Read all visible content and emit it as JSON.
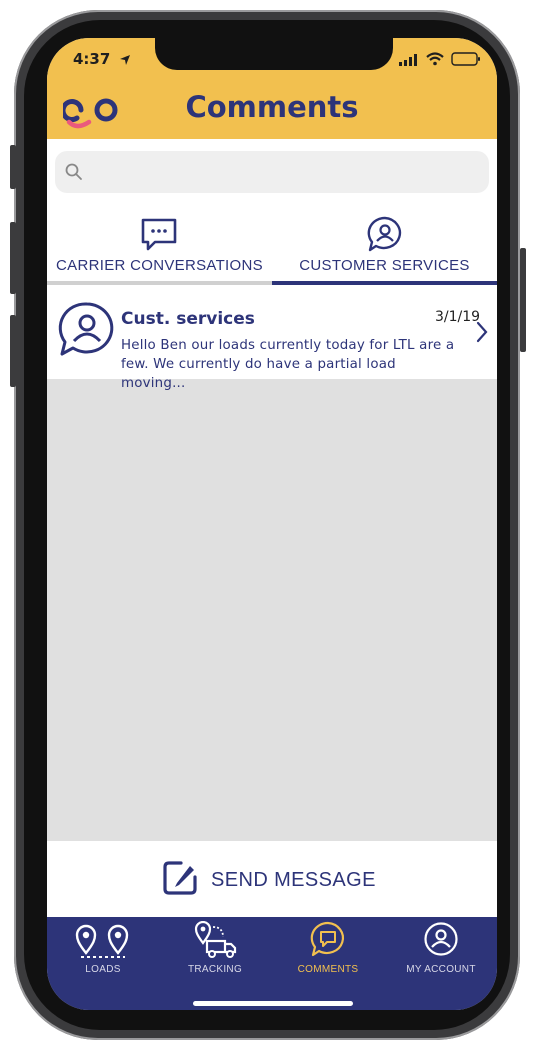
{
  "status_bar": {
    "time": "4:37"
  },
  "header": {
    "title": "Comments"
  },
  "search": {
    "placeholder": ""
  },
  "tabs": [
    {
      "label": "CARRIER CONVERSATIONS",
      "active": false
    },
    {
      "label": "CUSTOMER SERVICES",
      "active": true
    }
  ],
  "conversations": [
    {
      "name": "Cust. services",
      "date": "3/1/19",
      "preview_line1": "Hello Ben our loads currently today for LTL are a",
      "preview_line2": "few. We currently do have a partial load moving..."
    }
  ],
  "send": {
    "label": "SEND MESSAGE"
  },
  "nav": [
    {
      "label": "LOADS",
      "icon": "map-pins-icon"
    },
    {
      "label": "TRACKING",
      "icon": "truck-route-icon"
    },
    {
      "label": "COMMENTS",
      "icon": "chat-bubble-icon",
      "active": true
    },
    {
      "label": "MY ACCOUNT",
      "icon": "user-circle-icon"
    }
  ],
  "colors": {
    "brand_yellow": "#f2c04f",
    "brand_navy": "#2d3479"
  }
}
